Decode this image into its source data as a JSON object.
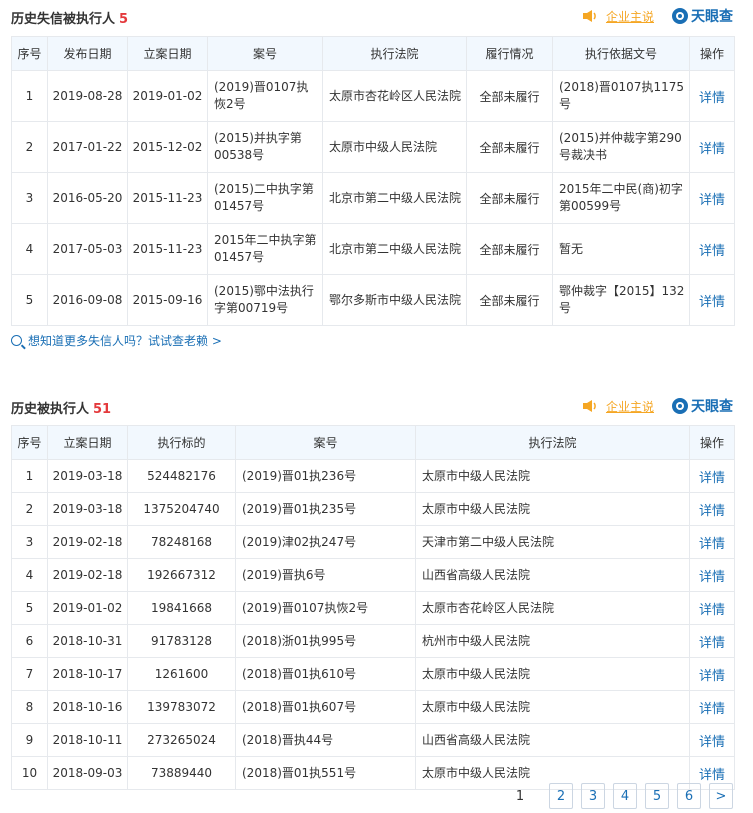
{
  "section1": {
    "title": "历史失信被执行人",
    "count": "5",
    "owner_link": "企业主说",
    "brand": "天眼查",
    "headers": [
      "序号",
      "发布日期",
      "立案日期",
      "案号",
      "执行法院",
      "履行情况",
      "执行依据文号",
      "操作"
    ],
    "rows": [
      {
        "no": "1",
        "pub": "2019-08-28",
        "filed": "2019-01-02",
        "case": "(2019)晋0107执恢2号",
        "court": "太原市杏花岭区人民法院",
        "status": "全部未履行",
        "basis": "(2018)晋0107执1175号",
        "op": "详情"
      },
      {
        "no": "2",
        "pub": "2017-01-22",
        "filed": "2015-12-02",
        "case": "(2015)并执字第00538号",
        "court": "太原市中级人民法院",
        "status": "全部未履行",
        "basis": "(2015)并仲裁字第290号裁决书",
        "op": "详情"
      },
      {
        "no": "3",
        "pub": "2016-05-20",
        "filed": "2015-11-23",
        "case": "(2015)二中执字第01457号",
        "court": "北京市第二中级人民法院",
        "status": "全部未履行",
        "basis": "2015年二中民(商)初字第00599号",
        "op": "详情"
      },
      {
        "no": "4",
        "pub": "2017-05-03",
        "filed": "2015-11-23",
        "case": "2015年二中执字第01457号",
        "court": "北京市第二中级人民法院",
        "status": "全部未履行",
        "basis": "暂无",
        "op": "详情"
      },
      {
        "no": "5",
        "pub": "2016-09-08",
        "filed": "2015-09-16",
        "case": "(2015)鄂中法执行字第00719号",
        "court": "鄂尔多斯市中级人民法院",
        "status": "全部未履行",
        "basis": "鄂仲裁字【2015】132号",
        "op": "详情"
      }
    ],
    "tip": "想知道更多失信人吗？试试查老赖 >"
  },
  "section2": {
    "title": "历史被执行人",
    "count": "51",
    "owner_link": "企业主说",
    "brand": "天眼查",
    "headers": [
      "序号",
      "立案日期",
      "执行标的",
      "案号",
      "执行法院",
      "操作"
    ],
    "rows": [
      {
        "no": "1",
        "filed": "2019-03-18",
        "amount": "524482176",
        "case": "(2019)晋01执236号",
        "court": "太原市中级人民法院",
        "op": "详情"
      },
      {
        "no": "2",
        "filed": "2019-03-18",
        "amount": "1375204740",
        "case": "(2019)晋01执235号",
        "court": "太原市中级人民法院",
        "op": "详情"
      },
      {
        "no": "3",
        "filed": "2019-02-18",
        "amount": "78248168",
        "case": "(2019)津02执247号",
        "court": "天津市第二中级人民法院",
        "op": "详情"
      },
      {
        "no": "4",
        "filed": "2019-02-18",
        "amount": "192667312",
        "case": "(2019)晋执6号",
        "court": "山西省高级人民法院",
        "op": "详情"
      },
      {
        "no": "5",
        "filed": "2019-01-02",
        "amount": "19841668",
        "case": "(2019)晋0107执恢2号",
        "court": "太原市杏花岭区人民法院",
        "op": "详情"
      },
      {
        "no": "6",
        "filed": "2018-10-31",
        "amount": "91783128",
        "case": "(2018)浙01执995号",
        "court": "杭州市中级人民法院",
        "op": "详情"
      },
      {
        "no": "7",
        "filed": "2018-10-17",
        "amount": "1261600",
        "case": "(2018)晋01执610号",
        "court": "太原市中级人民法院",
        "op": "详情"
      },
      {
        "no": "8",
        "filed": "2018-10-16",
        "amount": "139783072",
        "case": "(2018)晋01执607号",
        "court": "太原市中级人民法院",
        "op": "详情"
      },
      {
        "no": "9",
        "filed": "2018-10-11",
        "amount": "273265024",
        "case": "(2018)晋执44号",
        "court": "山西省高级人民法院",
        "op": "详情"
      },
      {
        "no": "10",
        "filed": "2018-09-03",
        "amount": "73889440",
        "case": "(2018)晋01执551号",
        "court": "太原市中级人民法院",
        "op": "详情"
      }
    ]
  },
  "pagination": {
    "current": "1",
    "pages": [
      "2",
      "3",
      "4",
      "5",
      "6"
    ],
    "next": ">"
  },
  "icons": {
    "owner": "speaker-icon",
    "brand": "tianyancha-logo-icon",
    "tip": "search-icon"
  },
  "colors": {
    "accent": "#1a6fb5",
    "count": "#e4393c",
    "owner": "#f5a623",
    "header_bg": "#f2f8fe"
  }
}
